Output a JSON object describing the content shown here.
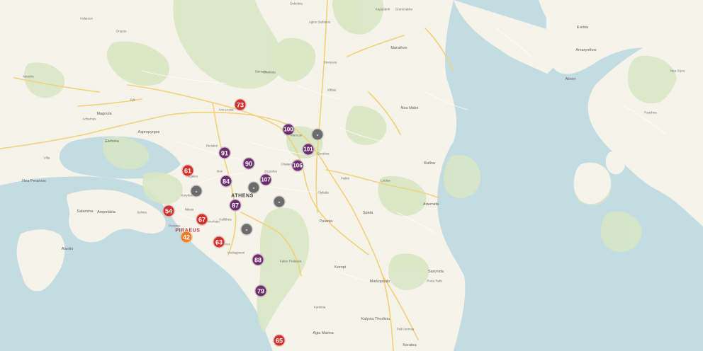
{
  "colors": {
    "water": "#c3dce2",
    "land": "#f6f4ea",
    "green": "#d8e7c5",
    "road_major": "#f4d98b",
    "road_minor": "#ffffff",
    "marker_red": "#d0312d",
    "marker_orange": "#f27a24",
    "marker_purple": "#6b2d6b",
    "marker_gray": "#6c6c6c"
  },
  "places": {
    "athens": "ATHENS",
    "piraeus": "PIRAEUS",
    "marathon": "Marathon",
    "elefsina": "Elefsina",
    "nea_makri": "Nea Makri",
    "rafina": "Rafina",
    "artemida": "Artemida",
    "spata": "Spata",
    "paiania": "Paiania",
    "koropi": "Koropi",
    "markopoulo": "Markopoulo",
    "salamina": "Salamina",
    "ampelakia": "Ampelakia",
    "aegina_side": "Aiantio",
    "megara_side": "Nea Peramos",
    "magoula": "Magoula",
    "ano_liosia": "Ano Liosia",
    "marousi": "Marousi",
    "chalandri": "Chalandri",
    "nikaia": "Nikaia",
    "korydallos": "Korydallos",
    "kallithea": "Kallithea",
    "vouliagmeni": "Vouliagmeni",
    "varkiza": "Varkiza",
    "kalyvia": "Kalyvia Thorikou",
    "agia_marina": "Agia Marina",
    "keratea": "Keratea",
    "lavrio_side": "Saronida",
    "dekeleia": "Dekeleia",
    "kapandriti": "Kapandriti",
    "grammatiko": "Grammatiko",
    "nea_styra": "Nea Styra",
    "eretria": "Eretria",
    "amarynthos": "Amarynthos",
    "aliveri": "Aliveri",
    "psachna": "Psachna",
    "kalamos": "Kalamos",
    "oropos": "Oropos",
    "chalkida": "Chalkida",
    "mandra": "Mandra",
    "fyli": "Fyli",
    "acharnes": "Acharnes",
    "kifisia": "Kifisia",
    "glyfada": "Glyfada",
    "porto_rafti": "Porto Rafti",
    "loutsa": "Loutsa",
    "pallini": "Pallini",
    "gerakas": "Gerakas",
    "aspropyrgos": "Aspropyrgos",
    "vilia": "Vilia",
    "stamata": "Stamata",
    "dionysos": "Dionysos",
    "agios_stefanos": "Agios Stefanos",
    "aegaleo": "Aegaleo",
    "peristeri": "Peristeri",
    "zografou": "Zografou",
    "ilion": "Ilion",
    "moschato": "Moschato",
    "alimos": "Alimos",
    "perama": "Perama",
    "kaminia": "Kaminia",
    "selinia": "Selinia",
    "psili_ammos": "Psili Ammos",
    "kakia_thalassa": "Kakia Thalassa"
  },
  "markers": [
    {
      "value": "73",
      "color": "red"
    },
    {
      "value": "100",
      "color": "purple"
    },
    {
      "value": "-",
      "color": "gray"
    },
    {
      "value": "101",
      "color": "purple"
    },
    {
      "value": "91",
      "color": "purple"
    },
    {
      "value": "90",
      "color": "purple"
    },
    {
      "value": "106",
      "color": "purple"
    },
    {
      "value": "61",
      "color": "red"
    },
    {
      "value": "84",
      "color": "purple"
    },
    {
      "value": "107",
      "color": "purple"
    },
    {
      "value": "-",
      "color": "gray"
    },
    {
      "value": "-",
      "color": "gray"
    },
    {
      "value": "87",
      "color": "purple"
    },
    {
      "value": "-",
      "color": "gray"
    },
    {
      "value": "54",
      "color": "red"
    },
    {
      "value": "67",
      "color": "red"
    },
    {
      "value": "-",
      "color": "gray"
    },
    {
      "value": "42",
      "color": "orange"
    },
    {
      "value": "63",
      "color": "red"
    },
    {
      "value": "88",
      "color": "purple"
    },
    {
      "value": "79",
      "color": "purple"
    },
    {
      "value": "65",
      "color": "red"
    }
  ]
}
